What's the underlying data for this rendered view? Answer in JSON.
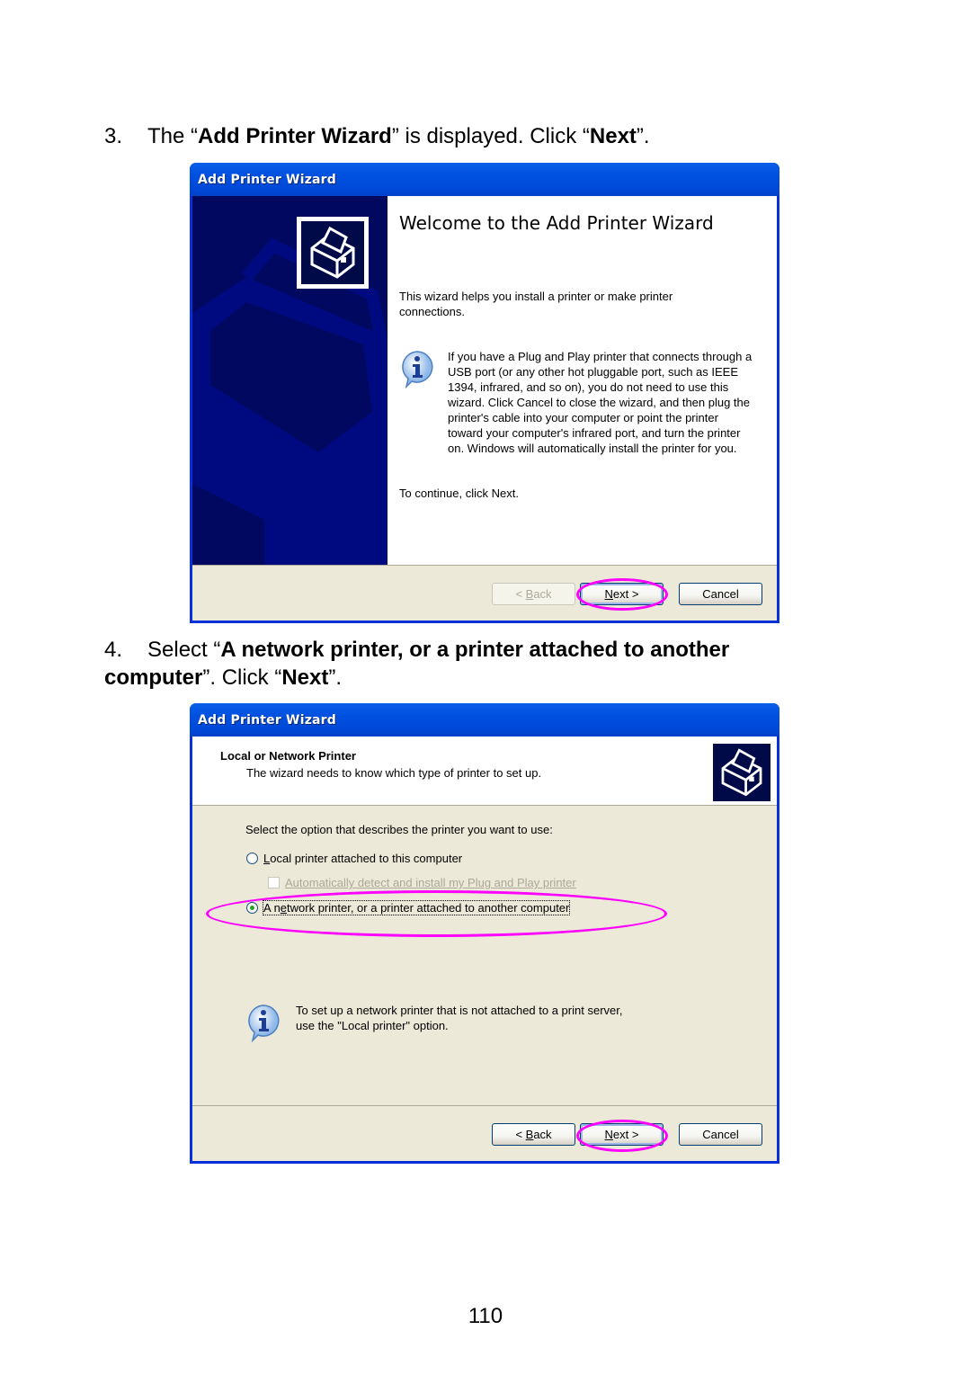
{
  "step3": {
    "number": "3.",
    "prefix": "The “",
    "bold1": "Add Printer Wizard",
    "mid": "” is displayed. Click “",
    "bold2": "Next",
    "suffix": "”."
  },
  "window1": {
    "title": "Add Printer Wizard",
    "heading": "Welcome to the Add Printer Wizard",
    "intro": "This wizard helps you install a printer or make printer connections.",
    "info_icon": "info-icon",
    "info_text": "If you have a Plug and Play printer that connects through a USB port (or any other hot pluggable port, such as IEEE 1394, infrared, and so on), you do not need to use this wizard. Click Cancel to close the wizard, and then plug the printer's cable into your computer or point the printer toward your computer's infrared port, and turn the printer on. Windows will automatically install the printer for you.",
    "continue_text": "To continue, click Next.",
    "buttons": {
      "back": {
        "prefix": "< ",
        "accel": "B",
        "rest": "ack",
        "enabled": false
      },
      "next": {
        "accel": "N",
        "rest": "ext >",
        "enabled": true
      },
      "cancel": {
        "label": "Cancel",
        "enabled": true
      }
    }
  },
  "step4": {
    "number": "4.",
    "prefix": "Select “",
    "bold1": "A network printer, or a printer attached to another computer",
    "mid": "”. Click “",
    "bold2": "Next",
    "suffix": "”."
  },
  "window2": {
    "title": "Add Printer Wizard",
    "header_title": "Local or Network Printer",
    "header_subtitle": "The wizard needs to know which type of printer to set up.",
    "prompt": "Select the option that describes the printer you want to use:",
    "options": [
      {
        "accel": "L",
        "rest": "ocal printer attached to this computer",
        "selected": false
      },
      {
        "label": "Automatically detect and install my Plug and Play printer",
        "checked": false,
        "enabled": false
      },
      {
        "pre": "A n",
        "accel": "e",
        "rest": "twork printer, or a printer attached to another computer",
        "selected": true
      }
    ],
    "info_text_line1": "To set up a network printer that is not attached to a print server,",
    "info_text_line2": "use the \"Local printer\" option.",
    "buttons": {
      "back": {
        "prefix": "< ",
        "accel": "B",
        "rest": "ack",
        "enabled": true
      },
      "next": {
        "accel": "N",
        "rest": "ext >",
        "enabled": true
      },
      "cancel": {
        "label": "Cancel",
        "enabled": true
      }
    }
  },
  "annotation_color": "#ff00ff",
  "page_number": "110"
}
